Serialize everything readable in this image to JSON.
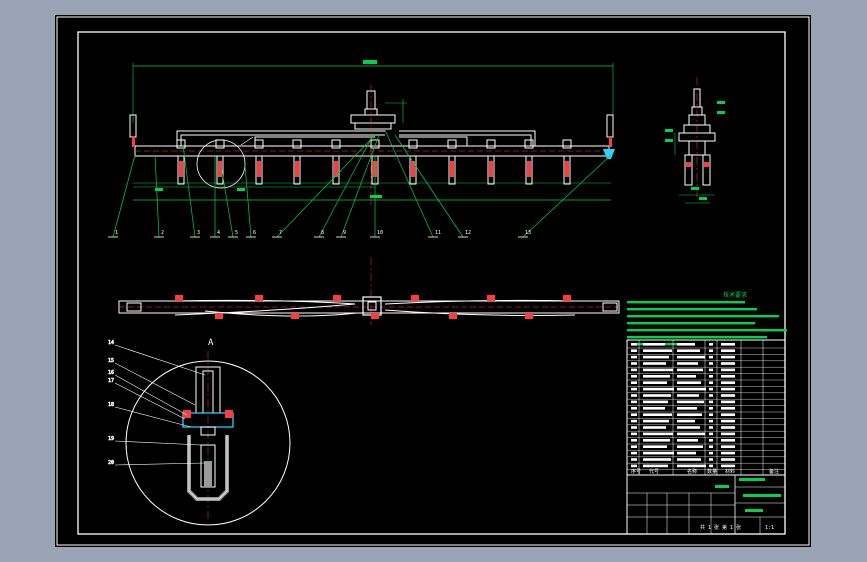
{
  "drawing": {
    "tech_requirements_title": "技术要求",
    "balloons_top": [
      "1",
      "2",
      "3",
      "4",
      "5",
      "6",
      "7",
      "8",
      "9",
      "10",
      "11",
      "12",
      "13"
    ],
    "balloons_detail": [
      "14",
      "15",
      "16",
      "17",
      "18",
      "19",
      "20"
    ],
    "detail_label": "A",
    "section_label": "A",
    "title_block": {
      "bom_header": [
        "序号",
        "代号",
        "名称",
        "数量",
        "材料",
        "备注"
      ],
      "scale": "1:1",
      "sheet": "共 1 张 第 1 张"
    }
  },
  "colors": {
    "background": "#000000",
    "frame": "#ffffff",
    "part": "#ffffff",
    "part_red": "#ff3b3b",
    "dimension": "#00d24a",
    "hatch": "#9a9a9a",
    "accent_cyan": "#29d3ff"
  }
}
